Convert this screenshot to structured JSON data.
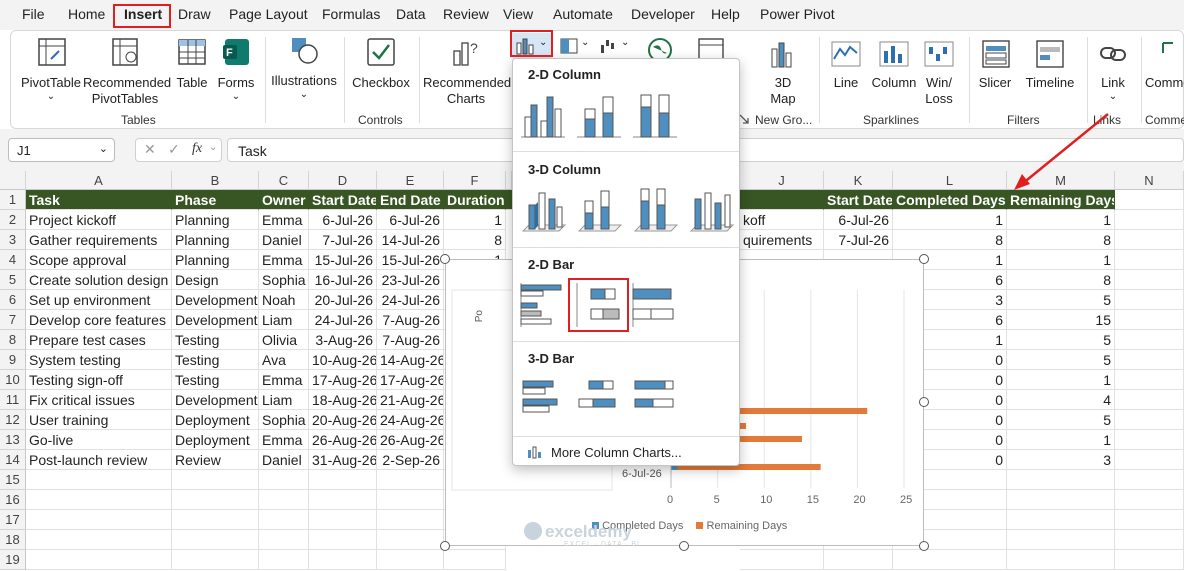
{
  "menu": [
    "File",
    "Home",
    "Insert",
    "Draw",
    "Page Layout",
    "Formulas",
    "Data",
    "Review",
    "View",
    "Automate",
    "Developer",
    "Help",
    "Power Pivot"
  ],
  "ribbon": {
    "pivottable": "PivotTable",
    "recommended_pivottables_1": "Recommended",
    "recommended_pivottables_2": "PivotTables",
    "table": "Table",
    "forms": "Forms",
    "illustrations": "Illustrations",
    "checkbox": "Checkbox",
    "recommended_charts_1": "Recommended",
    "recommended_charts_2": "Charts",
    "map3d_1": "3D",
    "map3d_2": "Map",
    "line": "Line",
    "column": "Column",
    "winloss_1": "Win/",
    "winloss_2": "Loss",
    "slicer": "Slicer",
    "timeline": "Timeline",
    "link": "Link",
    "comment": "Comme",
    "groups": {
      "tables": "Tables",
      "controls": "Controls",
      "newgro": "New Gro...",
      "sparklines": "Sparklines",
      "filters": "Filters",
      "links": "Links",
      "comments": "Comme"
    }
  },
  "formula_bar": {
    "name_box": "J1",
    "fx": "fx",
    "content": "Task"
  },
  "columns": [
    "A",
    "B",
    "C",
    "D",
    "E",
    "F",
    "J",
    "K",
    "L",
    "M",
    "N"
  ],
  "rows": [
    "1",
    "2",
    "3",
    "4",
    "5",
    "6",
    "7",
    "8",
    "9",
    "10",
    "11",
    "12",
    "13",
    "14",
    "15",
    "16",
    "17",
    "18",
    "19"
  ],
  "table_headers": [
    "Task",
    "Phase",
    "Owner",
    "Start Date",
    "End Date",
    "Duration"
  ],
  "table_rows": [
    [
      "Project kickoff",
      "Planning",
      "Emma",
      "6-Jul-26",
      "6-Jul-26",
      "1"
    ],
    [
      "Gather requirements",
      "Planning",
      "Daniel",
      "7-Jul-26",
      "14-Jul-26",
      "8"
    ],
    [
      "Scope approval",
      "Planning",
      "Emma",
      "15-Jul-26",
      "15-Jul-26",
      "1"
    ],
    [
      "Create solution design",
      "Design",
      "Sophia",
      "16-Jul-26",
      "23-Jul-26",
      ""
    ],
    [
      "Set up environment",
      "Development",
      "Noah",
      "20-Jul-26",
      "24-Jul-26",
      ""
    ],
    [
      "Develop core features",
      "Development",
      "Liam",
      "24-Jul-26",
      "7-Aug-26",
      ""
    ],
    [
      "Prepare test cases",
      "Testing",
      "Olivia",
      "3-Aug-26",
      "7-Aug-26",
      ""
    ],
    [
      "System testing",
      "Testing",
      "Ava",
      "10-Aug-26",
      "14-Aug-26",
      ""
    ],
    [
      "Testing sign-off",
      "Testing",
      "Emma",
      "17-Aug-26",
      "17-Aug-26",
      ""
    ],
    [
      "Fix critical issues",
      "Development",
      "Liam",
      "18-Aug-26",
      "21-Aug-26",
      ""
    ],
    [
      "User training",
      "Deployment",
      "Sophia",
      "20-Aug-26",
      "24-Aug-26",
      ""
    ],
    [
      "Go-live",
      "Deployment",
      "Emma",
      "26-Aug-26",
      "26-Aug-26",
      ""
    ],
    [
      "Post-launch review",
      "Review",
      "Daniel",
      "31-Aug-26",
      "2-Sep-26",
      ""
    ]
  ],
  "right_headers": [
    "",
    "Start Date",
    "Completed Days",
    "Remaining Days"
  ],
  "right_rows": [
    [
      "koff",
      "6-Jul-26",
      "1",
      "1"
    ],
    [
      "quirements",
      "7-Jul-26",
      "8",
      "8"
    ],
    [
      "",
      "",
      "1",
      "1"
    ],
    [
      "",
      "",
      "6",
      "8"
    ],
    [
      "",
      "",
      "3",
      "5"
    ],
    [
      "",
      "",
      "6",
      "15"
    ],
    [
      "",
      "",
      "1",
      "5"
    ],
    [
      "",
      "",
      "0",
      "5"
    ],
    [
      "",
      "",
      "0",
      "1"
    ],
    [
      "",
      "",
      "0",
      "4"
    ],
    [
      "",
      "",
      "0",
      "5"
    ],
    [
      "",
      "",
      "0",
      "1"
    ],
    [
      "",
      "",
      "0",
      "3"
    ]
  ],
  "dropdown": {
    "col2d": "2-D Column",
    "col3d": "3-D Column",
    "bar2d": "2-D Bar",
    "bar3d": "3-D Bar",
    "more": "More Column Charts..."
  },
  "chart_data": {
    "type": "bar",
    "series": [
      {
        "name": "Completed Days"
      },
      {
        "name": "Remaining Days"
      }
    ],
    "xticks": [
      "0",
      "5",
      "10",
      "15",
      "20",
      "25"
    ],
    "visible_category_label": "6-Jul-26",
    "visible_remaining_bars": [
      21,
      8,
      14,
      16
    ]
  },
  "watermark": "exceldemy",
  "watermark_sub": "EXCEL · DATA · BI",
  "colors": {
    "header_green": "#375623",
    "excel_green": "#217346",
    "bar_blue": "#4e8fbf",
    "bar_orange": "#e37a3a",
    "highlight_red": "#e02020"
  }
}
